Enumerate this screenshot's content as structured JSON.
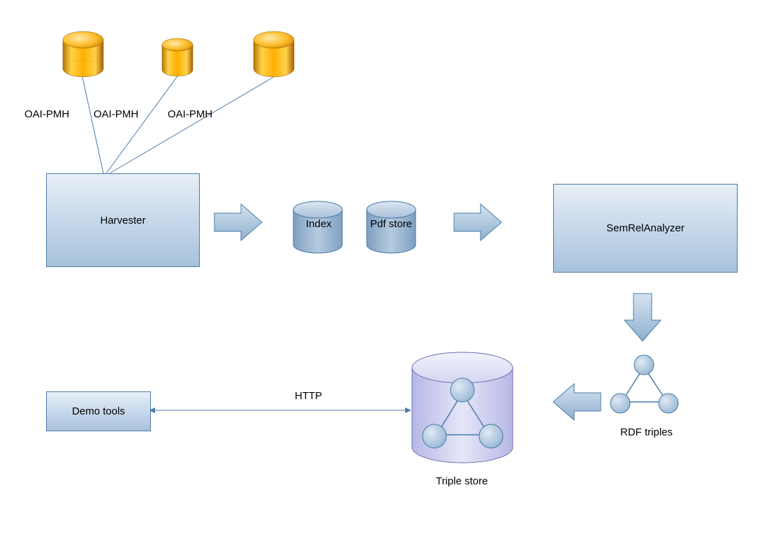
{
  "sources": {
    "label1": "OAI-PMH",
    "label2": "OAI-PMH",
    "label3": "OAI-PMH"
  },
  "harvester": {
    "label": "Harvester"
  },
  "index": {
    "label": "Index"
  },
  "pdfstore": {
    "label": "Pdf store"
  },
  "analyzer": {
    "label": "SemRelAnalyzer"
  },
  "rdf": {
    "label": "RDF triples"
  },
  "triplestore": {
    "label": "Triple store"
  },
  "demotools": {
    "label": "Demo tools"
  },
  "http": {
    "label": "HTTP"
  }
}
